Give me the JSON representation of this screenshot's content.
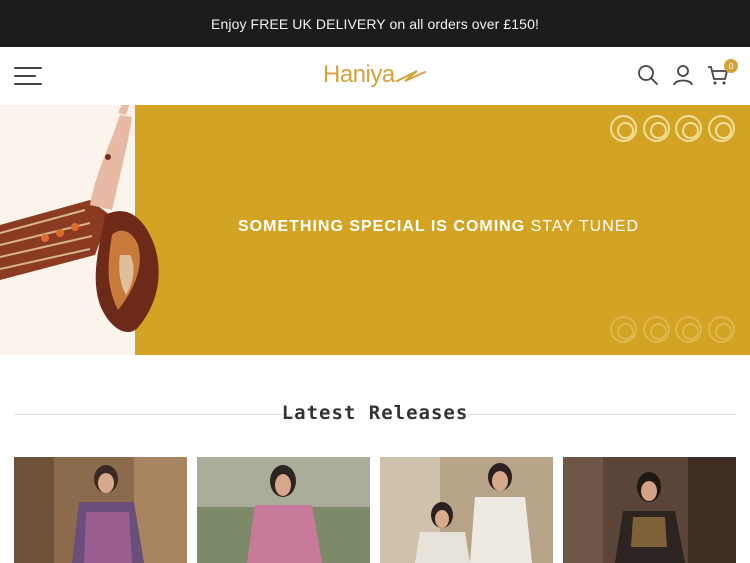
{
  "announcement": {
    "text": "Enjoy FREE UK DELIVERY on all orders over £150!"
  },
  "header": {
    "logo_text": "Haniya",
    "cart_count": "0",
    "icons": [
      "menu-icon",
      "search-icon",
      "user-icon",
      "cart-icon"
    ]
  },
  "banner": {
    "headline_bold": "SOMETHING SPECIAL IS COMING",
    "headline_light": "STAY TUNED",
    "colors": {
      "gold": "#d3a423",
      "cream": "#fbf4ec"
    }
  },
  "latest": {
    "title": "Latest Releases"
  },
  "products": [
    {
      "name": "product-1",
      "colors": [
        "#7a5a3f",
        "#6b4f7a"
      ]
    },
    {
      "name": "product-2",
      "colors": [
        "#5d6b4a",
        "#c97a9a"
      ]
    },
    {
      "name": "product-3",
      "colors": [
        "#b7a489",
        "#e8e3da"
      ]
    },
    {
      "name": "product-4",
      "colors": [
        "#4a3a2f",
        "#2b2420"
      ]
    }
  ],
  "brand": {
    "accent": "#d3a23a"
  }
}
